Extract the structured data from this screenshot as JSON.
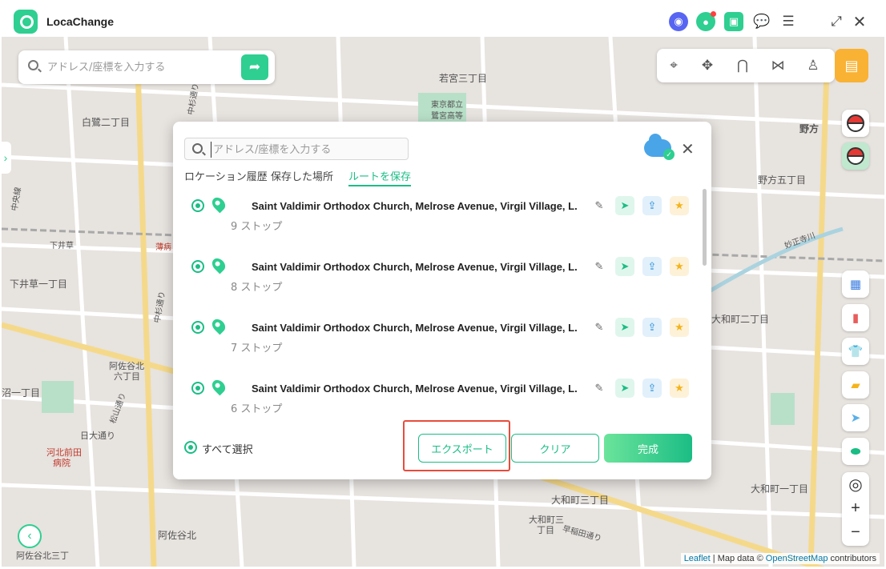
{
  "app": {
    "title": "LocaChange"
  },
  "map": {
    "search_placeholder": "アドレス/座標を入力する",
    "labels": [
      "若宮三丁目",
      "東京都立",
      "鷺宮高等",
      "白鷺二丁目",
      "野方",
      "野方五丁目",
      "妙正寺川",
      "下井草一丁目",
      "下井草",
      "薄病",
      "大和町二丁目",
      "阿佐谷北",
      "六丁目",
      "沼一丁目",
      "松山通り",
      "日大通り",
      "河北前田",
      "病院",
      "大和町三",
      "丁目",
      "早稲田通り",
      "大和町一丁目",
      "大和町三丁目",
      "阿佐谷北",
      "阿佐谷北三丁",
      "中杉通り",
      "中杉通り",
      "中央線"
    ],
    "attribution": {
      "leaflet": "Leaflet",
      "sep": "| Map data ©",
      "osm": "OpenStreetMap",
      "contrib": "contributors"
    }
  },
  "dialog": {
    "search_placeholder": "アドレス/座標を入力する",
    "tabs": [
      "ロケーション履歴",
      "保存した場所",
      "ルートを保存"
    ],
    "active_tab": 2,
    "routes": [
      {
        "name": "Saint Valdimir Orthodox Church, Melrose Avenue, Virgil Village, L.",
        "stops": "9 ストップ"
      },
      {
        "name": "Saint Valdimir Orthodox Church, Melrose Avenue, Virgil Village, L.",
        "stops": "8 ストップ"
      },
      {
        "name": "Saint Valdimir Orthodox Church, Melrose Avenue, Virgil Village, L.",
        "stops": "7 ストップ"
      },
      {
        "name": "Saint Valdimir Orthodox Church, Melrose Avenue, Virgil Village, L.",
        "stops": "6 ストップ"
      }
    ],
    "select_all": "すべて選択",
    "buttons": {
      "export": "エクスポート",
      "clear": "クリア",
      "done": "完成"
    }
  },
  "colors": {
    "accent": "#1bbd85",
    "highlight": "#e74c3c",
    "history": "#f9b233"
  }
}
